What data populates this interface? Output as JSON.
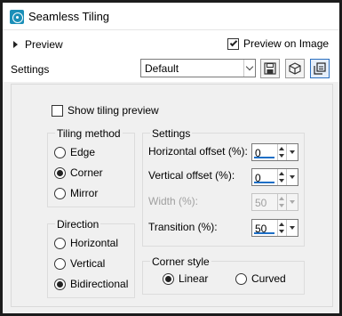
{
  "window": {
    "title": "Seamless Tiling",
    "app_icon": "seamless-tiling-app-icon"
  },
  "topbar": {
    "preview_label": "Preview",
    "preview_on_image_label": "Preview on Image",
    "preview_on_image_checked": true,
    "settings_label": "Settings",
    "settings_value": "Default",
    "tool_icons": [
      "save-preset-icon",
      "reset-preset-icon",
      "copy-settings-icon"
    ]
  },
  "show_tiling_preview": {
    "label": "Show tiling preview",
    "checked": false
  },
  "tiling_method": {
    "title": "Tiling method",
    "options": [
      "Edge",
      "Corner",
      "Mirror"
    ],
    "selected": "Corner"
  },
  "settings": {
    "title": "Settings",
    "horizontal_offset": {
      "label": "Horizontal offset (%):",
      "value": "0"
    },
    "vertical_offset": {
      "label": "Vertical offset (%):",
      "value": "0"
    },
    "width": {
      "label": "Width (%):",
      "value": "50",
      "disabled": true
    },
    "transition": {
      "label": "Transition (%):",
      "value": "50"
    }
  },
  "direction": {
    "title": "Direction",
    "options": [
      "Horizontal",
      "Vertical",
      "Bidirectional"
    ],
    "selected": "Bidirectional"
  },
  "corner_style": {
    "title": "Corner style",
    "options": [
      "Linear",
      "Curved"
    ],
    "selected": "Linear"
  },
  "colors": {
    "accent": "#1e6fc6",
    "panel_bg": "#f0f0f0",
    "window_border": "#1c1c1c"
  }
}
